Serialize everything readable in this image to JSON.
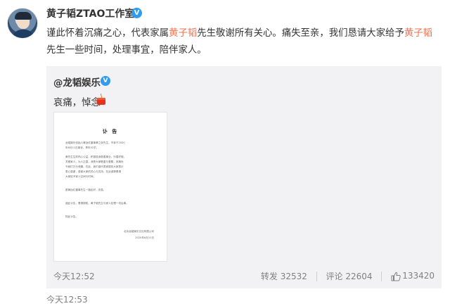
{
  "post": {
    "username": "黄子韬ZTAO工作室",
    "verified_mark": "V",
    "text_parts": [
      "谨此怀着沉痛之心，代表家属",
      "黄子韬",
      "先生敬谢所有关心。痛失至亲，我们恳请大家给予",
      "黄子韬",
      "先生一些时间，处理事宜，陪伴家人。"
    ],
    "time": "今天12:53"
  },
  "repost": {
    "username": "@龙韬娱乐",
    "verified_mark": "V",
    "text": "哀痛，悼念",
    "time": "今天12:52",
    "actions": {
      "forward": "转发 32532",
      "comment": "评论 22604",
      "like": "133420"
    },
    "document": {
      "title": "讣 告",
      "lines": [
        "龙韬娱乐创始人黄劢红董事黄之余先生，不幸于2020",
        "年6月11日离世，享年52岁。",
        "",
        "黄先生生前热心公益，积极投身慈善事业，乐善好施，",
        "关爱家人，为人正直，深受大家敬重与爱戴，其离世",
        "令我们万分悲痛。在此，我们谨代表家属向大家表示",
        "衷心感谢，感谢大家的关心与支持，在此诚挚恳请",
        "大家给予家人空间与时间。",
        "",
        "愿黄劢红董事先生一路走好，安息。",
        "",
        "谨此讣告，恳请周知。黄子韬先生与家人处理一切后事。",
        "",
        "特此讣告。"
      ],
      "signature": "北京龙韬娱乐文化有限公司",
      "date": "2020年6月11日"
    }
  },
  "colors": {
    "highlight": "#eb7350",
    "verified": "#2f9cf0",
    "repost_bg": "#f2f2f5"
  },
  "icons": [
    "verified-badge-icon",
    "candle-icon",
    "like-icon"
  ]
}
